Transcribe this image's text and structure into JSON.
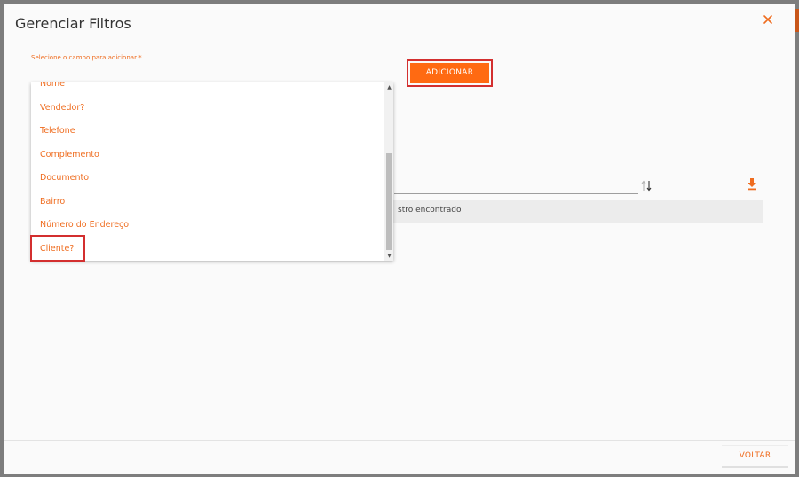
{
  "dialog": {
    "title": "Gerenciar Filtros",
    "close_icon": "close-icon"
  },
  "field": {
    "label": "Selecione o campo para adicionar *"
  },
  "add_button": {
    "label": "ADICIONAR"
  },
  "dropdown": {
    "items": [
      {
        "label": "Nome"
      },
      {
        "label": "Vendedor?"
      },
      {
        "label": "Telefone"
      },
      {
        "label": "Complemento"
      },
      {
        "label": "Documento"
      },
      {
        "label": "Bairro"
      },
      {
        "label": "Número do Endereço"
      },
      {
        "label": "Cliente?"
      }
    ],
    "highlighted_item": "Cliente?"
  },
  "table": {
    "empty_text": "stro encontrado",
    "sort_icon": "sort-arrows-icon",
    "download_icon": "download-icon"
  },
  "footer": {
    "back_label": "VOLTAR"
  },
  "colors": {
    "accent": "#ef6c1f",
    "button": "#ff6a12",
    "highlight": "#d32f2f"
  }
}
